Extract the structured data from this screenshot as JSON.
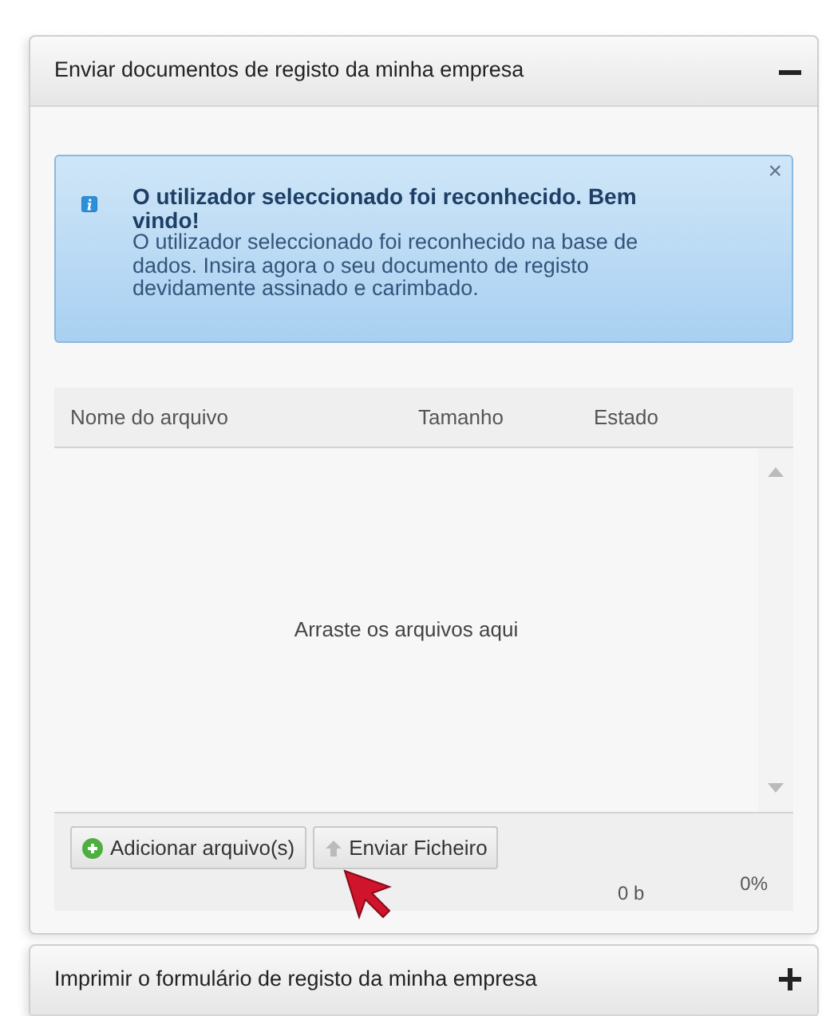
{
  "panels": [
    {
      "title": "Enviar documentos de registo da minha empresa",
      "expanded": true,
      "alert": {
        "heading": "O utilizador seleccionado foi reconhecido. Bem vindo!",
        "text": "O utilizador seleccionado foi reconhecido na base de dados. Insira agora o seu documento de registo devidamente assinado e carimbado.",
        "close": "×"
      },
      "uploader": {
        "columns": [
          "Nome do arquivo",
          "Tamanho",
          "Estado"
        ],
        "drop_hint": "Arraste os arquivos aqui",
        "buttons": [
          {
            "label": "Adicionar arquivo(s)",
            "kind": "add"
          },
          {
            "label": "Enviar Ficheiro",
            "kind": "upload"
          }
        ],
        "total_size": "0 b",
        "total_percent": "0%"
      }
    },
    {
      "title": "Imprimir o formulário de registo da minha empresa",
      "expanded": false
    }
  ]
}
